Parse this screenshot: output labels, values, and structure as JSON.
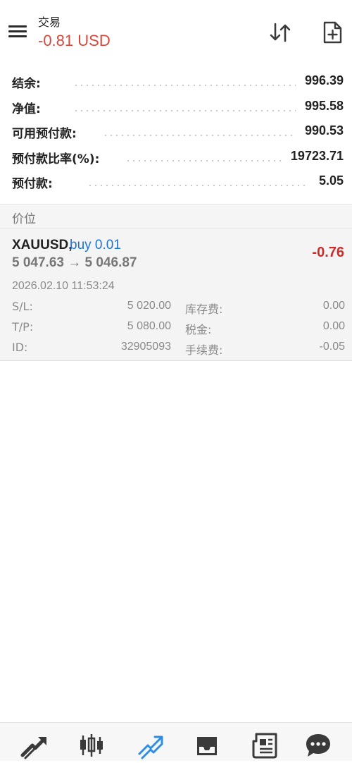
{
  "header": {
    "title": "交易",
    "subtitle": "-0.81 USD",
    "menu_icon": "hamburger-menu-icon",
    "sort_icon": "sort-arrows-icon",
    "new_order_icon": "new-document-plus-icon"
  },
  "account": [
    {
      "label": "结余:",
      "value": "996.39"
    },
    {
      "label": "净值:",
      "value": "995.58"
    },
    {
      "label": "可用预付款:",
      "value": "990.53"
    },
    {
      "label": "预付款比率(%):",
      "value": "19723.71"
    },
    {
      "label": "预付款:",
      "value": "5.05"
    }
  ],
  "section": {
    "title": "价位"
  },
  "position": {
    "symbol": "XAUUSD,",
    "side": "buy 0.01",
    "prices": "5 047.63 → 5 046.87",
    "profit": "-0.76",
    "time": "2026.02.10 11:53:24",
    "details": [
      {
        "label": "S/L:",
        "value": "5 020.00",
        "label2": "库存费:",
        "value2": "0.00"
      },
      {
        "label": "T/P:",
        "value": "5 080.00",
        "label2": "税金:",
        "value2": "0.00"
      },
      {
        "label": "ID:",
        "value": "32905093",
        "label2": "手续费:",
        "value2": "-0.05"
      }
    ]
  },
  "colors": {
    "loss_red": "#cf2a27",
    "header_red": "#d9473b",
    "buy_blue": "#1a73d9",
    "active_tab_blue": "#2f8de4",
    "icon_gray": "#3a3a3a"
  },
  "bottom_nav": [
    {
      "icon": "quotes-arrows-icon",
      "active": false
    },
    {
      "icon": "candlestick-chart-icon",
      "active": false
    },
    {
      "icon": "trade-chart-icon",
      "active": true
    },
    {
      "icon": "history-inbox-icon",
      "active": false
    },
    {
      "icon": "news-icon",
      "active": false
    },
    {
      "icon": "messages-chat-icon",
      "active": false
    }
  ]
}
